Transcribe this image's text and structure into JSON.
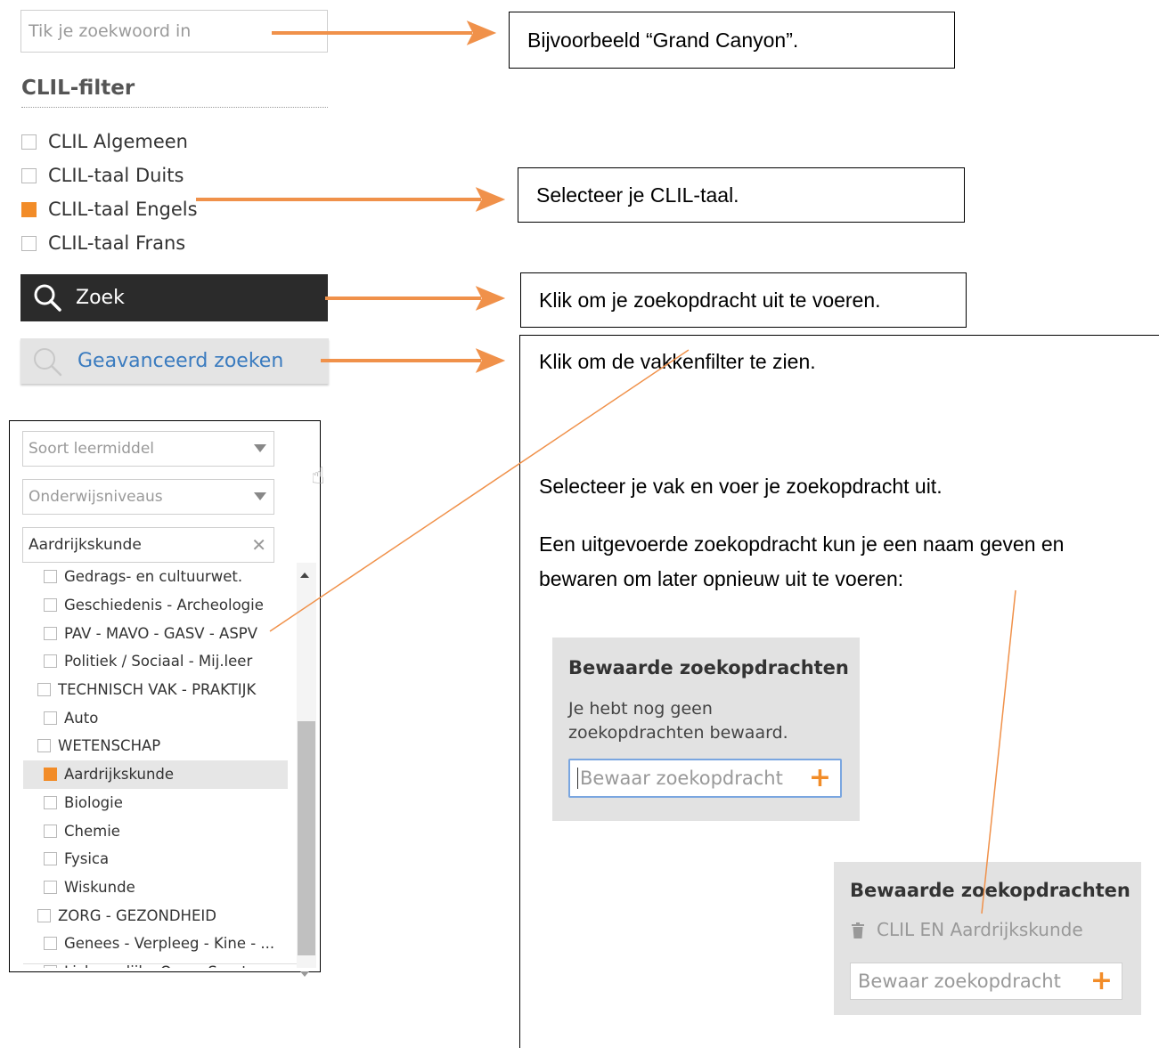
{
  "search": {
    "placeholder": "Tik je zoekwoord in"
  },
  "clil_filter": {
    "title": "CLIL-filter",
    "options": [
      {
        "label": "CLIL Algemeen",
        "checked": false
      },
      {
        "label": "CLIL-taal Duits",
        "checked": false
      },
      {
        "label": "CLIL-taal Engels",
        "checked": true
      },
      {
        "label": "CLIL-taal Frans",
        "checked": false
      }
    ]
  },
  "buttons": {
    "search": "Zoek",
    "advanced": "Geavanceerd zoeken"
  },
  "callouts": {
    "search_example": "Bijvoorbeeld “Grand Canyon”.",
    "select_language": "Selecteer je CLIL-taal.",
    "click_search": "Klik om je zoekopdracht uit te voeren.",
    "click_advanced": "Klik om de vakkenfilter te zien.",
    "select_subject": "Selecteer je vak en voer je zoekopdracht uit.",
    "save_line1": "Een uitgevoerde zoekopdracht kun je een naam geven en",
    "save_line2": "bewaren om later opnieuw uit te voeren:"
  },
  "advanced_panel": {
    "type_select": "Soort leermiddel",
    "level_select": "Onderwijsniveaus",
    "subject_select": "Aardrijkskunde",
    "subjects": [
      {
        "label": "Gedrags- en cultuurwet.",
        "indent": 1,
        "checked": false
      },
      {
        "label": "Geschiedenis - Archeologie",
        "indent": 1,
        "checked": false
      },
      {
        "label": "PAV - MAVO - GASV - ASPV",
        "indent": 1,
        "checked": false
      },
      {
        "label": "Politiek / Sociaal - Mij.leer",
        "indent": 1,
        "checked": false
      },
      {
        "label": "TECHNISCH VAK - PRAKTIJK",
        "indent": 0,
        "checked": false
      },
      {
        "label": "Auto",
        "indent": 1,
        "checked": false
      },
      {
        "label": "WETENSCHAP",
        "indent": 0,
        "checked": false
      },
      {
        "label": "Aardrijkskunde",
        "indent": 1,
        "checked": true
      },
      {
        "label": "Biologie",
        "indent": 1,
        "checked": false
      },
      {
        "label": "Chemie",
        "indent": 1,
        "checked": false
      },
      {
        "label": "Fysica",
        "indent": 1,
        "checked": false
      },
      {
        "label": "Wiskunde",
        "indent": 1,
        "checked": false
      },
      {
        "label": "ZORG - GEZONDHEID",
        "indent": 0,
        "checked": false
      },
      {
        "label": "Genees - Verpleeg - Kine - ...",
        "indent": 1,
        "checked": false
      },
      {
        "label": "Lichamelijke Opv. - Sport",
        "indent": 1,
        "checked": false
      }
    ]
  },
  "saved_empty": {
    "title": "Bewaarde zoekopdrachten",
    "message_line1": "Je hebt nog geen",
    "message_line2": "zoekopdrachten bewaard.",
    "input_placeholder": "Bewaar zoekopdracht"
  },
  "saved_filled": {
    "title": "Bewaarde zoekopdrachten",
    "item": "CLIL EN Aardrijkskunde",
    "input_placeholder": "Bewaar zoekopdracht"
  },
  "colors": {
    "accent": "#f28c28",
    "link": "#3a7bbf",
    "dark_button": "#2b2b2b"
  }
}
